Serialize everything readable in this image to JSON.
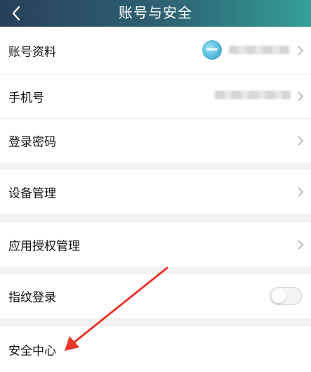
{
  "header": {
    "title": "账号与安全",
    "back_icon": "chevron-left-icon"
  },
  "rows": [
    {
      "label": "账号资料"
    },
    {
      "label": "手机号"
    },
    {
      "label": "登录密码"
    },
    {
      "label": "设备管理"
    },
    {
      "label": "应用授权管理"
    },
    {
      "label": "指纹登录"
    },
    {
      "label": "安全中心"
    }
  ],
  "fingerprint_toggle": {
    "on": false
  },
  "colors": {
    "header_start": "#28405a",
    "header_end": "#34a09a",
    "arrow": "#e8362a"
  }
}
